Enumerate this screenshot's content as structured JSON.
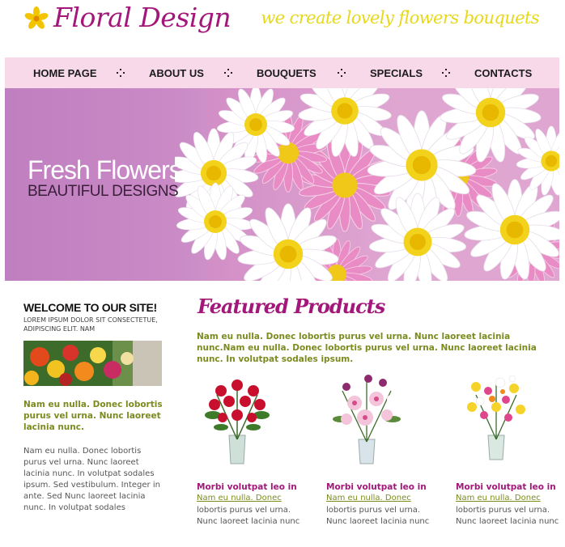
{
  "header": {
    "logo_text": "Floral Design",
    "tagline": "we create lovely flowers bouquets"
  },
  "nav": {
    "items": [
      "HOME PAGE",
      "ABOUT US",
      "BOUQUETS",
      "SPECIALS",
      "CONTACTS"
    ]
  },
  "hero": {
    "title": "Fresh Flowers",
    "subtitle": "BEAUTIFUL DESIGNS"
  },
  "sidebar": {
    "welcome": "WELCOME TO OUR SITE!",
    "lorem_small": "LOREM IPSUM DOLOR SIT CONSECTETUE, ADIPISCING ELIT. NAM",
    "green_text": "Nam eu nulla. Donec lobortis purus vel urna. Nunc laoreet lacinia nunc.",
    "body_text": "Nam eu nulla. Donec lobortis purus vel urna. Nunc laoreet lacinia nunc. In volutpat sodales ipsum. Sed vestibulum. Integer in ante. Sed Nunc laoreet lacinia nunc. In volutpat sodales"
  },
  "featured": {
    "title": "Featured Products",
    "intro": "Nam eu nulla. Donec lobortis purus vel urna. Nunc laoreet lacinia nunc.Nam eu nulla. Donec lobortis purus vel urna. Nunc laoreet lacinia nunc. In volutpat sodales ipsum.",
    "products": [
      {
        "name": "Morbi volutpat leo in",
        "link": "Nam eu nulla. Donec",
        "desc": "lobortis purus vel urna. Nunc laoreet lacinia nunc"
      },
      {
        "name": "Morbi volutpat leo in",
        "link": "Nam eu nulla. Donec",
        "desc": "lobortis purus vel urna. Nunc laoreet lacinia nunc"
      },
      {
        "name": "Morbi volutpat leo in",
        "link": "Nam eu nulla. Donec",
        "desc": "lobortis purus vel urna. Nunc laoreet lacinia nunc"
      }
    ]
  },
  "colors": {
    "brand_magenta": "#a3177a",
    "tagline_yellow": "#e7d81a",
    "nav_bg": "#f8d9ea",
    "olive_green": "#7c8a1e"
  }
}
